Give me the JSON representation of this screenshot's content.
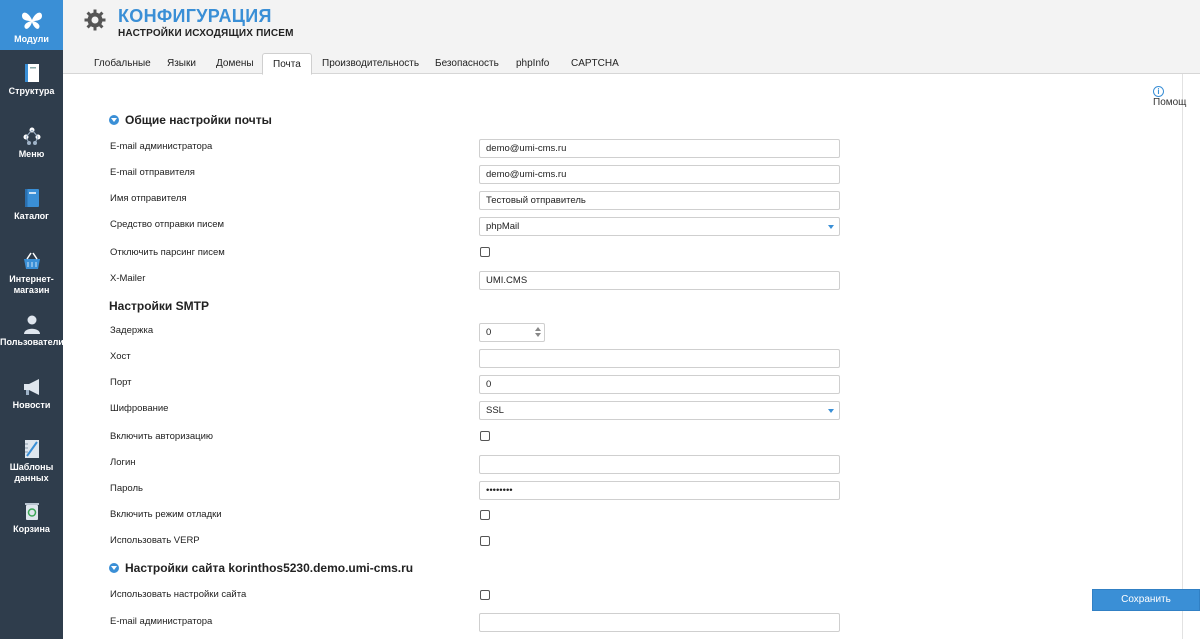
{
  "sidebar": {
    "items": [
      {
        "label": "Модули",
        "icon": "butterfly-icon"
      },
      {
        "label": "Структура",
        "icon": "structure-icon"
      },
      {
        "label": "Меню",
        "icon": "menu-tree-icon"
      },
      {
        "label": "Каталог",
        "icon": "catalog-book-icon"
      },
      {
        "label": "Интернет-магазин",
        "icon": "basket-icon"
      },
      {
        "label": "Пользователи",
        "icon": "user-icon"
      },
      {
        "label": "Новости",
        "icon": "megaphone-icon"
      },
      {
        "label": "Шаблоны данных",
        "icon": "ruler-icon"
      },
      {
        "label": "Корзина",
        "icon": "trash-bin-icon"
      }
    ],
    "active_color": "#3a8fd6",
    "bg_color": "#2f3d4c"
  },
  "header": {
    "title": "КОНФИГУРАЦИЯ",
    "subtitle": "НАСТРОЙКИ ИСХОДЯЩИХ ПИСЕМ"
  },
  "tabs": [
    {
      "label": "Глобальные"
    },
    {
      "label": "Языки"
    },
    {
      "label": "Домены"
    },
    {
      "label": "Почта",
      "active": true
    },
    {
      "label": "Производительность"
    },
    {
      "label": "Безопасность"
    },
    {
      "label": "phpInfo"
    },
    {
      "label": "CAPTCHA"
    }
  ],
  "help_label": "Помощ",
  "sections": {
    "general": {
      "title": "Общие настройки почты",
      "admin_email_label": "E-mail администратора",
      "admin_email_value": "demo@umi-cms.ru",
      "sender_email_label": "E-mail отправителя",
      "sender_email_value": "demo@umi-cms.ru",
      "sender_name_label": "Имя отправителя",
      "sender_name_value": "Тестовый отправитель",
      "transport_label": "Средство отправки писем",
      "transport_value": "phpMail",
      "disable_parsing_label": "Отключить парсинг писем",
      "xmailer_label": "X-Mailer",
      "xmailer_value": "UMI.CMS"
    },
    "smtp": {
      "title": "Настройки SMTP",
      "delay_label": "Задержка",
      "delay_value": "0",
      "host_label": "Хост",
      "host_value": "",
      "port_label": "Порт",
      "port_value": "0",
      "encryption_label": "Шифрование",
      "encryption_value": "SSL",
      "auth_label": "Включить авторизацию",
      "login_label": "Логин",
      "login_value": "",
      "password_label": "Пароль",
      "password_value": "••••••••",
      "debug_label": "Включить режим отладки",
      "verp_label": "Использовать VERP"
    },
    "site": {
      "title": "Настройки сайта korinthos5230.demo.umi-cms.ru",
      "use_site_settings_label": "Использовать настройки сайта",
      "admin_email_label": "E-mail администратора",
      "admin_email_value": ""
    }
  },
  "save_label": "Сохранить",
  "accent_color": "#3a8fd6"
}
